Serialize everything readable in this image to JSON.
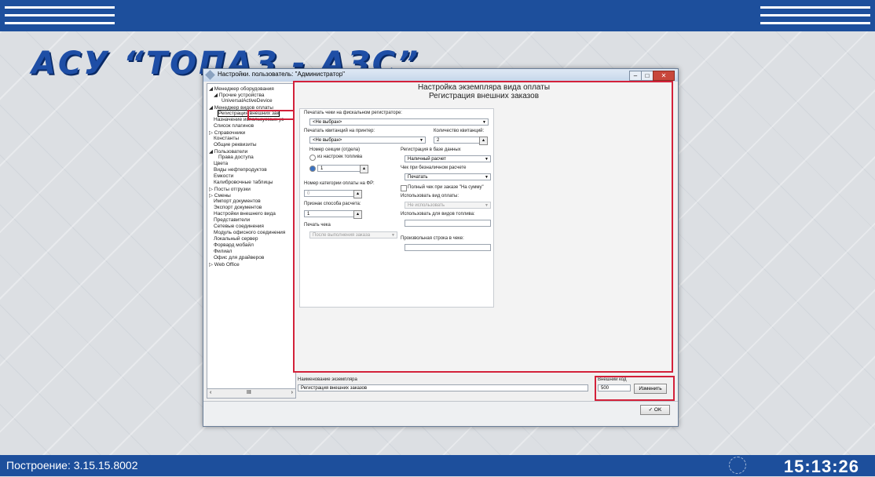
{
  "app_title": "АСУ “ТОПАЗ - АЗС”",
  "status": {
    "build": "Построение: 3.15.15.8002",
    "clock": "15:13:26"
  },
  "window": {
    "title": "Настройки. пользователь: \"Администратор\"",
    "min_icon": "minimize-icon",
    "max_icon": "maximize-icon",
    "close_icon": "close-icon"
  },
  "tree": [
    "◢ Менеджер оборудования",
    "◢ Прочие устройства",
    "UniversalActiveDevice",
    "◢ Менеджер видов оплаты",
    "Регистрация внешних зак",
    "Назначение используемых ус",
    "Список плагинов",
    "▷ Справочники",
    "Константы",
    "Общие реквизиты",
    "◢ Пользователи",
    "Права доступа",
    "Цвета",
    "Виды нефтепродуктов",
    "Емкости",
    "Калибровочные таблицы",
    "▷ Посты отгрузки",
    "▷ Смены",
    "Импорт документов",
    "Экспорт документов",
    "Настройки внешнего вида",
    "Представители",
    "Сетевые соединения",
    "Модуль офисного соединения",
    "Локальный сервер",
    "Форвард мобайл",
    "Филиал",
    "Офис для драйверов",
    "▷ Web Office"
  ],
  "panel": {
    "header1": "Настройка экземпляра вида оплаты",
    "header2": "Регистрация внешних заказов",
    "fiscal_label": "Печатать чеки на фискальном регистраторе:",
    "fiscal_value": "<Не выбран>",
    "printer_label": "Печатать квитанций на принтер:",
    "printer_value": "<Не выбран>",
    "copies_label": "Количество квитанций:",
    "copies_value": "2",
    "section_label": "Номер секции (отдела)",
    "from_fuel_label": "из настроек топлива",
    "section_value": "1",
    "category_label": "Номер категории оплаты на ФР:",
    "category_value": "0",
    "calc_label": "Признак способа расчета:",
    "calc_value": "1",
    "print_label": "Печать чека",
    "print_value": "После выполнения заказа",
    "db_label": "Регистрация в базе данных",
    "db_value": "Наличный расчет",
    "cashless_label": "Чек при безналичном расчете",
    "cashless_value": "Печатать",
    "full_check_label": "Полный чек при заказе \"На сумму\"",
    "use_pay_label": "Использовать вид оплаты:",
    "use_pay_value": "Не использовать",
    "fuel_types_label": "Использовать для видов топлива:",
    "custom_line_label": "Произвольная строка в чеке:"
  },
  "bottom": {
    "name_label": "Наименование экземпляра",
    "name_value": "Регистрация внешних заказов",
    "ext_code_label": "Внешний код",
    "ext_code_value": "500",
    "change_button": "Изменить",
    "ok_button": "OK"
  },
  "colors": {
    "bar": "#1d4f9c",
    "highlight": "#d3213a"
  }
}
